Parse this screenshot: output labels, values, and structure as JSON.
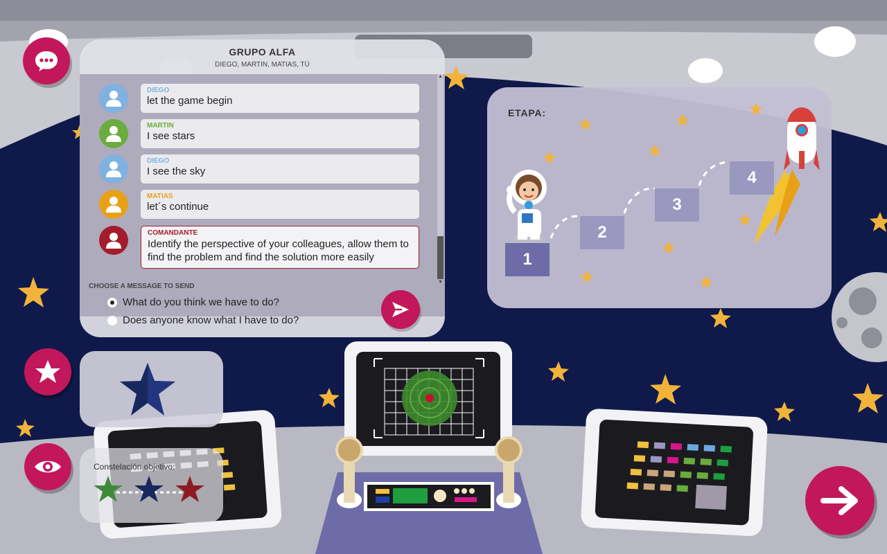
{
  "chat": {
    "title": "GRUPO ALFA",
    "members": "DIEGO, MARTIN, MATIAS, TÚ",
    "messages": [
      {
        "sender": "DIEGO",
        "text": "let the game begin",
        "color": "#7fb2e0"
      },
      {
        "sender": "MARTIN",
        "text": "I see stars",
        "color": "#6aac3e"
      },
      {
        "sender": "DIEGO",
        "text": "I see the sky",
        "color": "#7fb2e0"
      },
      {
        "sender": "MATIAS",
        "text": "let´s continue",
        "color": "#e8a117"
      },
      {
        "sender": "COMANDANTE",
        "text": "Identify the perspective of your colleagues, allow them to find the problem and find the solution more easily",
        "color": "#a31d2a"
      }
    ],
    "choose_label": "CHOOSE A MESSAGE TO SEND",
    "options": [
      {
        "text": "What do you think we have to do?",
        "selected": true
      },
      {
        "text": "Does anyone know what I have to do?",
        "selected": false
      }
    ]
  },
  "progress": {
    "label": "ETAPA:",
    "steps": [
      "1",
      "2",
      "3",
      "4"
    ],
    "current_step": 1
  },
  "constellation": {
    "label": "Constelación objetivo:",
    "star_colors": [
      "#3f8a3a",
      "#18275e",
      "#8e1b22"
    ],
    "main_star_color": "#18275e"
  },
  "colors": {
    "accent": "#c2185b",
    "sky": "#0f1a4a",
    "panel": "#aeabbd"
  }
}
